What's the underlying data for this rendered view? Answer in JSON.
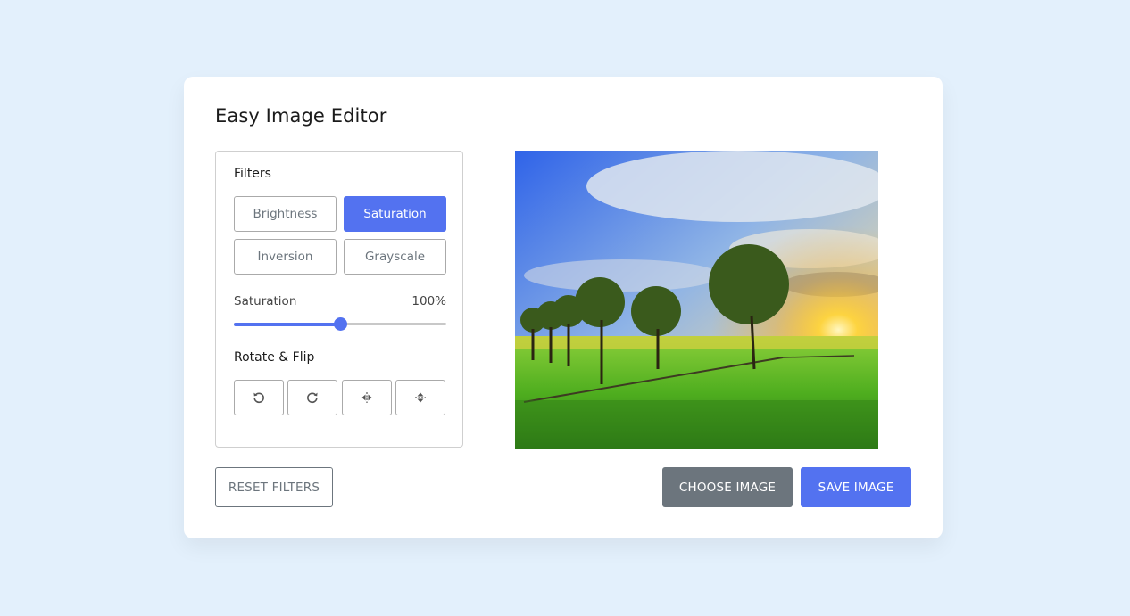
{
  "app": {
    "title": "Easy Image Editor"
  },
  "filters": {
    "label": "Filters",
    "buttons": [
      {
        "label": "Brightness",
        "active": false
      },
      {
        "label": "Saturation",
        "active": true
      },
      {
        "label": "Inversion",
        "active": false
      },
      {
        "label": "Grayscale",
        "active": false
      }
    ],
    "slider": {
      "name": "Saturation",
      "value_text": "100%",
      "fraction": 0.5
    }
  },
  "rotate": {
    "label": "Rotate & Flip",
    "buttons": [
      {
        "icon": "rotate-left-icon"
      },
      {
        "icon": "rotate-right-icon"
      },
      {
        "icon": "flip-horizontal-icon"
      },
      {
        "icon": "flip-vertical-icon"
      }
    ]
  },
  "actions": {
    "reset": "RESET FILTERS",
    "choose": "CHOOSE IMAGE",
    "save": "SAVE IMAGE"
  },
  "colors": {
    "accent": "#5372f0",
    "secondary": "#6c757d",
    "background": "#e3f0fc"
  }
}
